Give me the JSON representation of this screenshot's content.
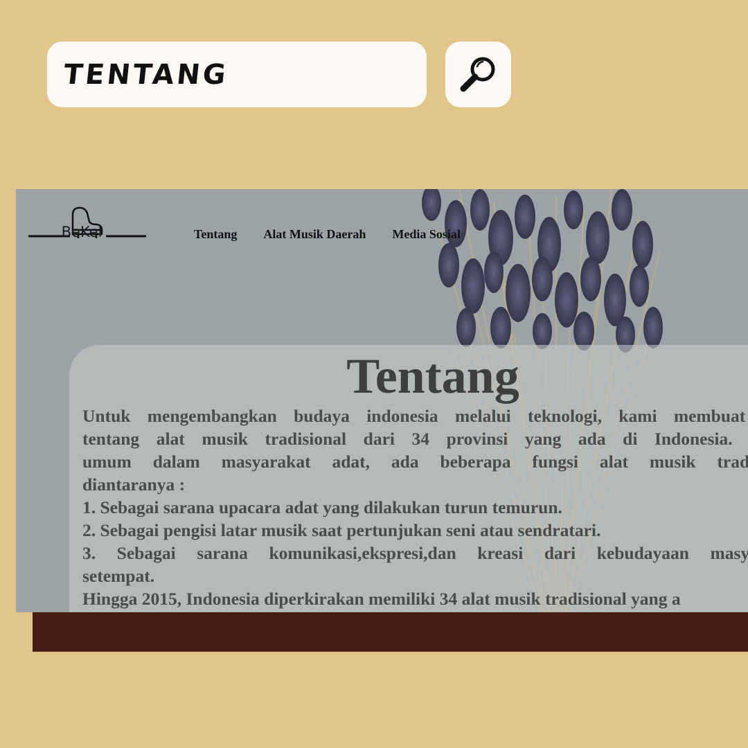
{
  "search": {
    "value": "TENTANG",
    "icon": "magnifier-icon"
  },
  "site": {
    "brand": "BeKel",
    "logo_icon": "piano-icon",
    "nav": [
      "Tentang",
      "Alat Musik Daerah",
      "Media Sosial"
    ],
    "about": {
      "title": "Tentang",
      "lines": [
        "Untuk mengembangkan budaya indonesia melalui teknologi, kami membuat w",
        "tentang alat musik tradisional dari 34 provinsi yang ada di Indonesia. Sec",
        "umum dalam masyarakat adat, ada beberapa fungsi alat musik tradisio",
        "diantaranya :",
        "1. Sebagai sarana upacara adat yang dilakukan turun temurun.",
        "2. Sebagai pengisi latar musik saat pertunjukan seni atau sendratari.",
        "3. Sebagai sarana komunikasi,ekspresi,dan kreasi dari kebudayaan masyara",
        "setempat.",
        "Hingga 2015, Indonesia diperkirakan memiliki 34 alat musik tradisional yang a"
      ]
    }
  },
  "colors": {
    "background": "#e1c58b",
    "footer": "#461e16",
    "site_bg": "#9ba3a6"
  }
}
